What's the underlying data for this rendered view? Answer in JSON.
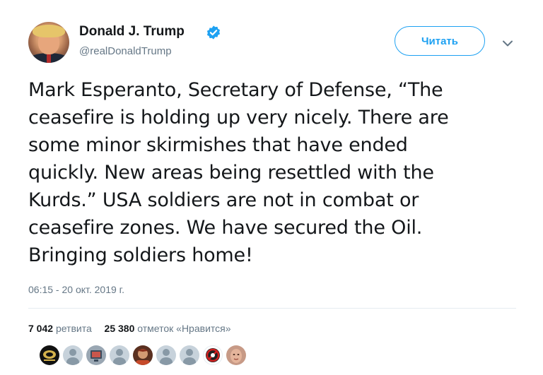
{
  "author": {
    "display_name": "Donald J. Trump",
    "handle": "@realDonaldTrump",
    "verified": true
  },
  "follow_button": {
    "label": "Читать"
  },
  "tweet": {
    "lines": [
      "Mark Esperanto, Secretary of Defense, “The",
      "ceasefire is holding up very nicely. There are",
      "some minor skirmishes that have ended",
      "quickly. New areas being resettled with the",
      "Kurds.” USA soldiers are not in combat or",
      "ceasefire zones. We have secured the Oil.",
      "Bringing soldiers home!"
    ],
    "timestamp": "06:15 - 20 окт. 2019 г."
  },
  "stats": {
    "retweets_count": "7 042",
    "retweets_label": "ретвита",
    "likes_count": "25 380",
    "likes_label": "отметок «Нравится»"
  },
  "likers": [
    {
      "type": "photo",
      "icon": "dark-emblem-avatar"
    },
    {
      "type": "default"
    },
    {
      "type": "photo",
      "icon": "screen-avatar"
    },
    {
      "type": "default"
    },
    {
      "type": "photo",
      "icon": "person-photo-avatar"
    },
    {
      "type": "default"
    },
    {
      "type": "default"
    },
    {
      "type": "photo",
      "icon": "no-sign-avatar"
    },
    {
      "type": "photo",
      "icon": "face-photo-avatar"
    }
  ],
  "colors": {
    "accent": "#1da1f2",
    "text": "#14171a",
    "secondary_text": "#657786",
    "divider": "#e6ecf0"
  }
}
